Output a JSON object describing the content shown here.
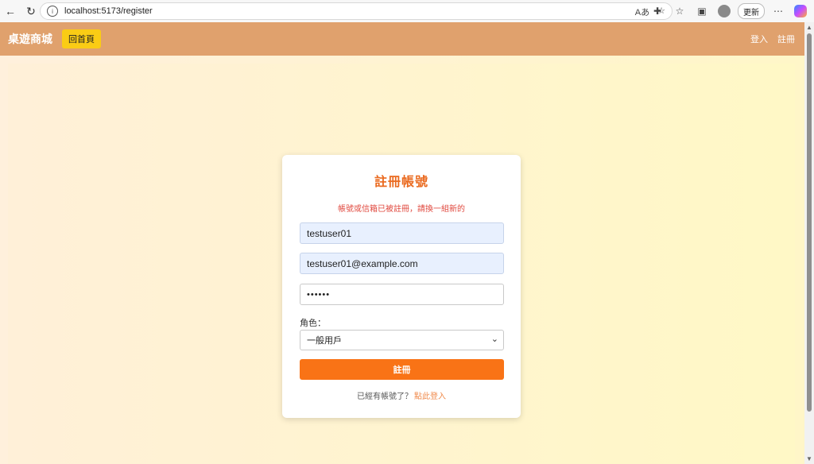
{
  "browser": {
    "url": "localhost:5173/register",
    "update_label": "更新"
  },
  "header": {
    "brand": "桌遊商城",
    "home_button": "回首頁",
    "nav": [
      "登入",
      "註冊"
    ]
  },
  "form": {
    "title": "註冊帳號",
    "error": "帳號或信箱已被註冊，請換一組新的",
    "username_value": "testuser01",
    "email_value": "testuser01@example.com",
    "password_value": "••••••",
    "role_label": "角色：",
    "role_selected": "一般用戶",
    "submit_label": "註冊",
    "footer_text": "已經有帳號了？",
    "footer_link": "點此登入"
  },
  "colors": {
    "header_bg": "#e0a16d",
    "accent": "#f97316",
    "title": "#ea6a1f",
    "error": "#e0483e",
    "home_button_bg": "#facc15"
  }
}
